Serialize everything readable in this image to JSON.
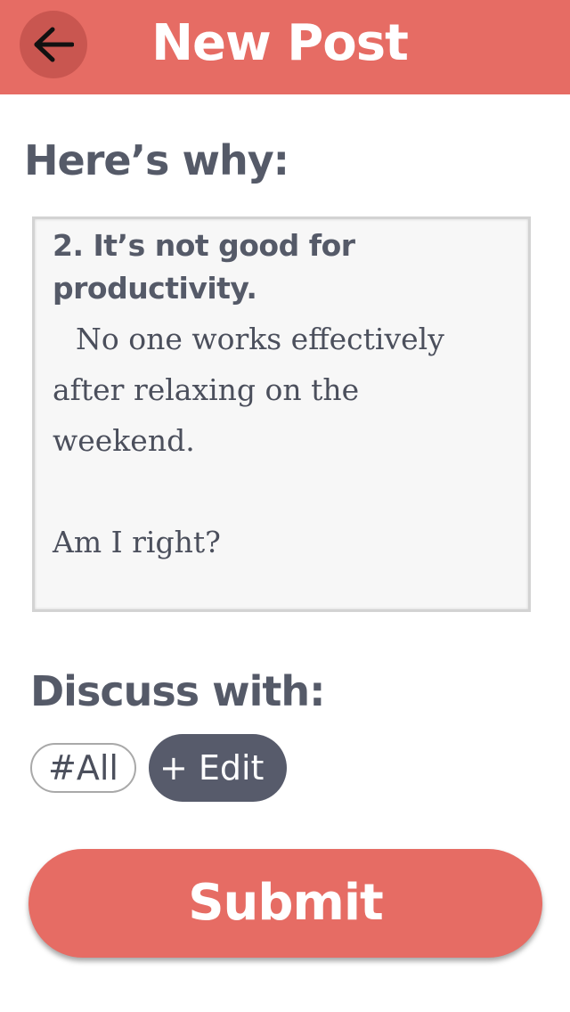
{
  "header": {
    "title": "New Post",
    "back_icon": "arrow-left-icon",
    "background_color": "#e66c64"
  },
  "why": {
    "heading": "Here’s why:"
  },
  "post": {
    "subheading_line1": "2. It’s not good for",
    "subheading_line2": "productivity.",
    "body": "No one works effectively after relaxing on the weekend.",
    "closing": "Am I right?"
  },
  "discuss": {
    "heading": "Discuss with:",
    "tags": [
      {
        "label": "#All"
      }
    ],
    "edit_label": "+ Edit"
  },
  "submit": {
    "label": "Submit",
    "color": "#e66c64"
  }
}
